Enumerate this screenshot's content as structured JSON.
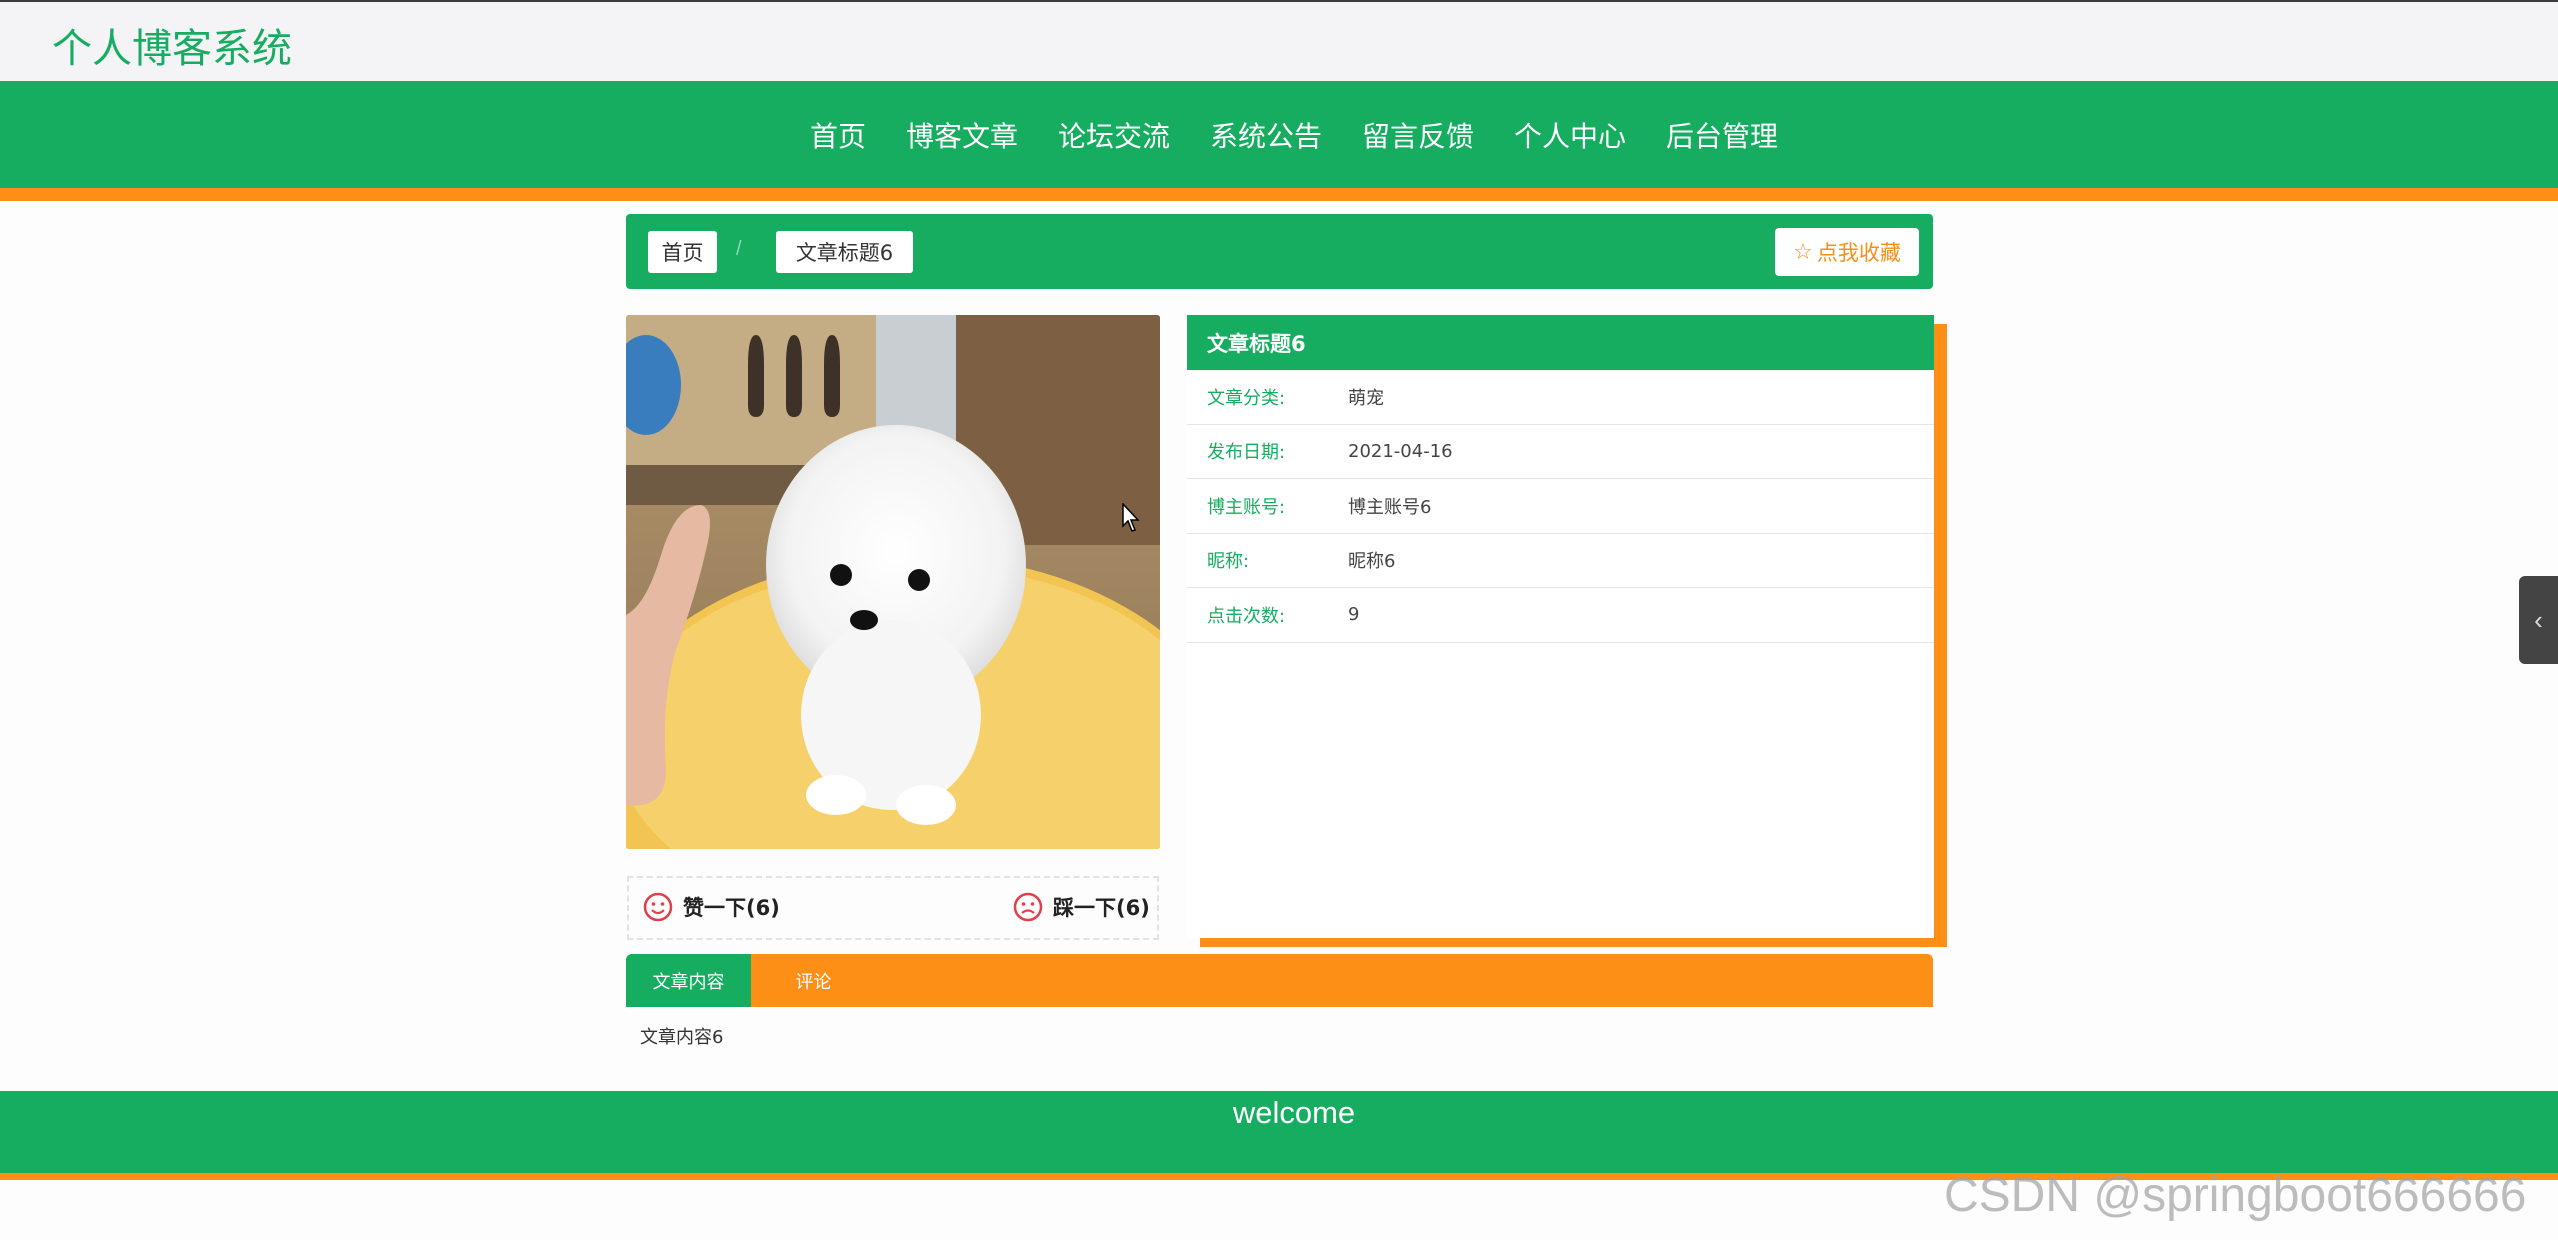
{
  "site": {
    "title": "个人博客系统"
  },
  "nav": {
    "items": [
      "首页",
      "博客文章",
      "论坛交流",
      "系统公告",
      "留言反馈",
      "个人中心",
      "后台管理"
    ]
  },
  "breadcrumb": {
    "home": "首页",
    "separator": "/",
    "current": "文章标题6"
  },
  "favorite_button": {
    "icon": "star-outline-icon",
    "label": "点我收藏"
  },
  "article": {
    "title": "文章标题6",
    "fields": [
      {
        "label": "文章分类:",
        "value": "萌宠"
      },
      {
        "label": "发布日期:",
        "value": "2021-04-16"
      },
      {
        "label": "博主账号:",
        "value": "博主账号6"
      },
      {
        "label": "昵称:",
        "value": "昵称6"
      },
      {
        "label": "点击次数:",
        "value": "9"
      }
    ],
    "image_subject": "white-pomeranian-puppy-photo",
    "content": "文章内容6"
  },
  "votes": {
    "like": {
      "icon": "smile-face-icon",
      "label": "赞一下(6)"
    },
    "dislike": {
      "icon": "frown-face-icon",
      "label": "踩一下(6)"
    }
  },
  "tabs": {
    "content": "文章内容",
    "comment": "评论"
  },
  "footer": {
    "text": "welcome"
  },
  "side_toggle": {
    "icon": "chevron-left-icon",
    "glyph": "‹"
  },
  "watermark": "CSDN @springboot666666",
  "colors": {
    "primary": "#16ad61",
    "accent": "#fd8f17",
    "vote_icon": "#e0404a"
  }
}
